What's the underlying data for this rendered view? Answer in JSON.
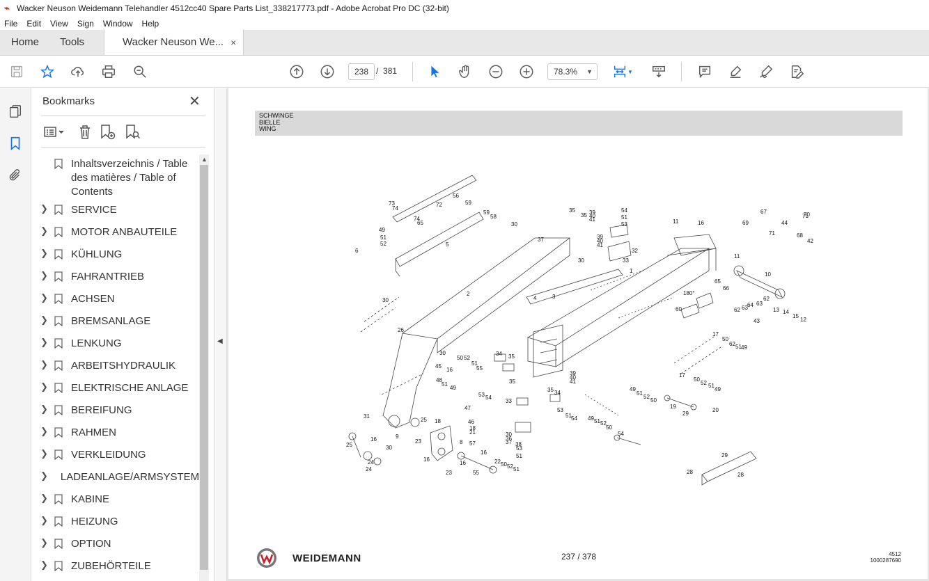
{
  "window": {
    "title": "Wacker Neuson Weidemann Telehandler 4512cc40 Spare Parts List_338217773.pdf - Adobe Acrobat Pro DC (32-bit)"
  },
  "menu": [
    "File",
    "Edit",
    "View",
    "Sign",
    "Window",
    "Help"
  ],
  "tabs": {
    "home": "Home",
    "tools": "Tools",
    "document": "Wacker Neuson We...",
    "close_glyph": "×"
  },
  "toolbar": {
    "current_page": "238",
    "page_separator": "/",
    "total_pages": "381",
    "zoom": "78.3%",
    "icons": [
      "save-icon",
      "star-icon",
      "upload-icon",
      "print-icon",
      "zoom-search-icon",
      "page-up-icon",
      "page-down-icon",
      "select-cursor-icon",
      "hand-icon",
      "zoom-out-icon",
      "zoom-in-icon",
      "fit-page-icon",
      "scroll-mode-icon",
      "comment-icon",
      "highlight-icon",
      "sign-icon",
      "edit-pdf-icon"
    ]
  },
  "bookmarks": {
    "header": "Bookmarks",
    "items": [
      "Inhaltsverzeichnis / Table des matières / Table of Contents",
      "SERVICE",
      "MOTOR ANBAUTEILE",
      "KÜHLUNG",
      "FAHRANTRIEB",
      "ACHSEN",
      "BREMSANLAGE",
      "LENKUNG",
      "ARBEITSHYDRAULIK",
      "ELEKTRISCHE ANLAGE",
      "BEREIFUNG",
      "RAHMEN",
      "VERKLEIDUNG",
      "LADEANLAGE/ARMSYSTEM",
      "KABINE",
      "HEIZUNG",
      "OPTION",
      "ZUBEHÖRTEILE"
    ]
  },
  "document": {
    "header_lines": [
      "SCHWINGE",
      "BIELLE",
      "WING"
    ],
    "brand": "WEIDEMANN",
    "page_label": "237 / 378",
    "model": "4512",
    "doc_number": "1000287690",
    "callouts": [
      "73",
      "74",
      "72",
      "56",
      "59",
      "59",
      "58",
      "74",
      "65",
      "5",
      "49",
      "51",
      "52",
      "6",
      "30",
      "37",
      "35",
      "35",
      "39",
      "40",
      "41",
      "54",
      "51",
      "53",
      "39",
      "40",
      "41",
      "32",
      "33",
      "30",
      "11",
      "16",
      "67",
      "69",
      "44",
      "71",
      "70",
      "71",
      "68",
      "42",
      "11",
      "10",
      "2",
      "1",
      "65",
      "66",
      "180°",
      "60",
      "62",
      "63",
      "64",
      "63",
      "62",
      "13",
      "14",
      "15",
      "12",
      "4",
      "3",
      "30",
      "26",
      "43",
      "17",
      "50",
      "62",
      "51",
      "49",
      "34",
      "35",
      "30",
      "16",
      "45",
      "50",
      "52",
      "51",
      "55",
      "35",
      "39",
      "40",
      "41",
      "17",
      "50",
      "52",
      "51",
      "49",
      "48",
      "51",
      "49",
      "53",
      "54",
      "47",
      "46",
      "18",
      "21",
      "57",
      "33",
      "35",
      "34",
      "53",
      "51",
      "54",
      "49",
      "51",
      "52",
      "50",
      "49",
      "51",
      "52",
      "50",
      "19",
      "29",
      "31",
      "25",
      "18",
      "9",
      "25",
      "16",
      "23",
      "8",
      "30",
      "16",
      "24",
      "16",
      "24",
      "16",
      "22",
      "50",
      "52",
      "51",
      "55",
      "23",
      "30",
      "36",
      "37",
      "38",
      "53",
      "51",
      "54",
      "20",
      "29",
      "28",
      "28",
      "7"
    ]
  }
}
